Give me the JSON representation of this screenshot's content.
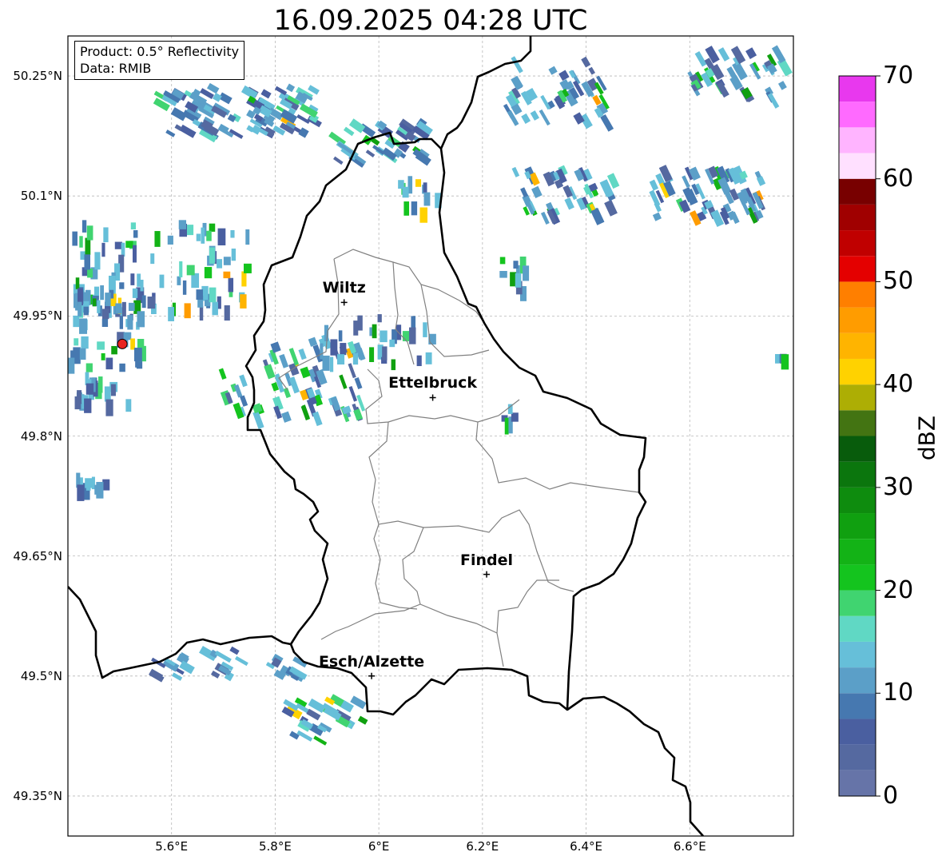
{
  "title": "16.09.2025 04:28 UTC",
  "info_box": {
    "product": "Product: 0.5° Reflectivity",
    "data": "Data: RMIB"
  },
  "map": {
    "lat_range": [
      49.3,
      50.3
    ],
    "lon_range": [
      5.4,
      6.8
    ],
    "lat_ticks": [
      "50.25°N",
      "50.1°N",
      "49.95°N",
      "49.8°N",
      "49.65°N",
      "49.5°N",
      "49.35°N"
    ],
    "lon_ticks": [
      "5.6°E",
      "5.8°E",
      "6°E",
      "6.2°E",
      "6.4°E",
      "6.6°E"
    ],
    "cities": [
      {
        "name": "Wiltz",
        "lat": 49.967,
        "lon": 5.933
      },
      {
        "name": "Ettelbruck",
        "lat": 49.848,
        "lon": 6.104
      },
      {
        "name": "Findel",
        "lat": 49.627,
        "lon": 6.208
      },
      {
        "name": "Esch/Alzette",
        "lat": 49.5,
        "lon": 5.986
      }
    ],
    "radar_site": {
      "lat": 49.915,
      "lon": 5.505,
      "color": "#e8231f"
    }
  },
  "colorbar": {
    "unit": "dBZ",
    "min": 0,
    "max": 70,
    "step": 2.5,
    "tick_labels": [
      "0",
      "10",
      "20",
      "30",
      "40",
      "50",
      "60",
      "70"
    ],
    "colors": [
      "#6674a8",
      "#5569a0",
      "#4a5fa0",
      "#4678b0",
      "#5b9fc8",
      "#66bfd9",
      "#60d8c4",
      "#40d470",
      "#14c41e",
      "#13b316",
      "#10a010",
      "#0e8c0e",
      "#0b760d",
      "#085c0c",
      "#437412",
      "#adae04",
      "#ffd200",
      "#ffb400",
      "#ff9c00",
      "#ff7f00",
      "#e40000",
      "#c00000",
      "#a00000",
      "#780000",
      "#ffe0ff",
      "#ffb4ff",
      "#ff6aff",
      "#e838ee"
    ]
  }
}
